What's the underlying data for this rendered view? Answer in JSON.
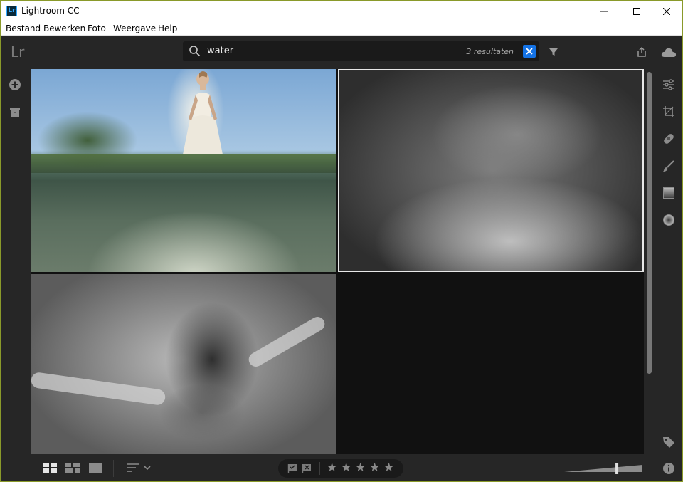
{
  "window": {
    "title": "Lightroom CC",
    "app_icon_text": "Lr",
    "border_color": "#8a9a2a"
  },
  "menu": [
    {
      "label": "Bestand"
    },
    {
      "label": "Bewerken"
    },
    {
      "label": "Foto"
    },
    {
      "label": "Weergave"
    },
    {
      "label": "Help"
    }
  ],
  "toolbar": {
    "logo": "Lr",
    "search": {
      "value": "water",
      "result_count": "3 resultaten"
    }
  },
  "left_rail": {
    "icons": [
      "add-photos-icon",
      "library-icon"
    ]
  },
  "right_rail": {
    "icons": [
      "edit-sliders-icon",
      "crop-icon",
      "healing-icon",
      "brush-icon",
      "linear-gradient-icon",
      "radial-gradient-icon",
      "keywords-icon",
      "info-icon"
    ]
  },
  "grid": {
    "photos": [
      {
        "name": "bride-in-water-color",
        "selected": false
      },
      {
        "name": "underwater-dress-bw",
        "selected": true
      },
      {
        "name": "underwater-girl-bw",
        "selected": false
      }
    ]
  },
  "bottom_bar": {
    "view_modes": [
      "square-grid",
      "photo-grid",
      "detail"
    ],
    "active_view": "square-grid",
    "stars": [
      "★",
      "★",
      "★",
      "★",
      "★"
    ],
    "rating": 0,
    "thumbnail_size": 0.68
  },
  "colors": {
    "accent": "#1473e6",
    "panel": "#262626",
    "grid_bg": "#111111"
  }
}
